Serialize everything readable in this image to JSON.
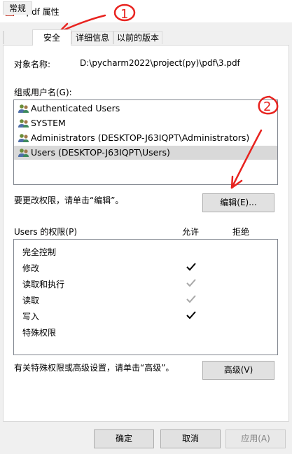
{
  "window": {
    "title": "3.pdf 属性"
  },
  "tabs": [
    {
      "label": "常规"
    },
    {
      "label": "安全"
    },
    {
      "label": "详细信息"
    },
    {
      "label": "以前的版本"
    }
  ],
  "security": {
    "object_label": "对象名称:",
    "object_value": "D:\\pycharm2022\\project(py)\\pdf\\3.pdf",
    "groups_label": "组或用户名(G):",
    "users": [
      {
        "name": "Authenticated Users",
        "selected": false
      },
      {
        "name": "SYSTEM",
        "selected": false
      },
      {
        "name": "Administrators (DESKTOP-J63IQPT\\Administrators)",
        "selected": false
      },
      {
        "name": "Users (DESKTOP-J63IQPT\\Users)",
        "selected": true
      }
    ],
    "change_hint": "要更改权限，请单击“编辑”。",
    "edit_button": "编辑(E)...",
    "perm_title": "Users 的权限(P)",
    "allow_col": "允许",
    "deny_col": "拒绝",
    "permissions": [
      {
        "name": "完全控制",
        "allow": "none"
      },
      {
        "name": "修改",
        "allow": "checked"
      },
      {
        "name": "读取和执行",
        "allow": "inherited"
      },
      {
        "name": "读取",
        "allow": "inherited"
      },
      {
        "name": "写入",
        "allow": "checked"
      },
      {
        "name": "特殊权限",
        "allow": "none"
      }
    ],
    "advanced_hint": "有关特殊权限或高级设置，请单击“高级”。",
    "advanced_button": "高级(V)"
  },
  "footer": {
    "ok": "确定",
    "cancel": "取消",
    "apply": "应用(A)"
  },
  "annotations": {
    "color": "#e8231f",
    "mark1": "1",
    "mark2": "2"
  }
}
